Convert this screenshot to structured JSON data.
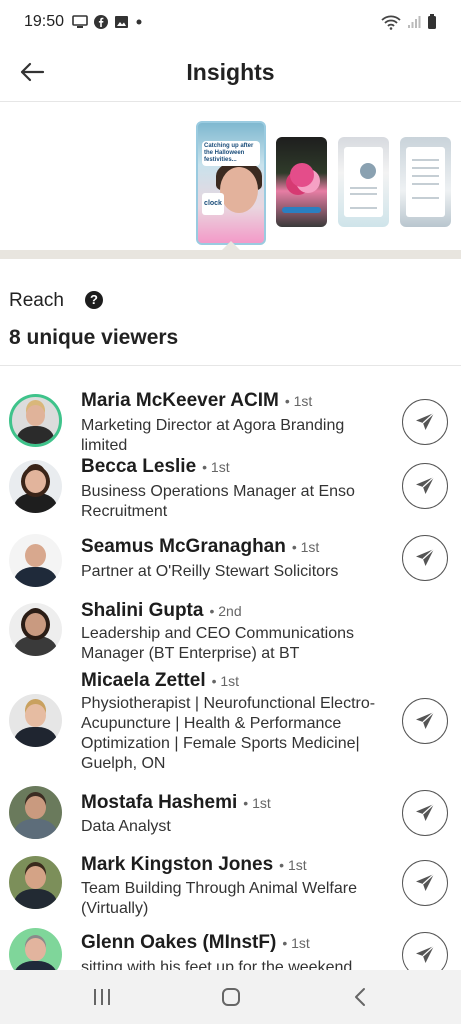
{
  "status_bar": {
    "time": "19:50",
    "left_icons": [
      "monitor-icon",
      "facebook-icon",
      "image-icon",
      "dot-icon"
    ],
    "right_icons": [
      "wifi-icon",
      "signal-icon",
      "battery-icon"
    ]
  },
  "header": {
    "title": "Insights",
    "back_icon": "arrow-left-icon"
  },
  "stories": {
    "items": [
      {
        "caption": "Catching up after the Halloween festivities...",
        "brand": "clock",
        "selected": true
      },
      {
        "caption": "",
        "selected": false
      },
      {
        "caption": "",
        "selected": false
      },
      {
        "caption": "",
        "selected": false
      }
    ]
  },
  "reach": {
    "label": "Reach",
    "help": "?",
    "count_text": "8 unique viewers"
  },
  "viewers": [
    {
      "name": "Maria McKeever ACIM",
      "degree": "• 1st",
      "headline": "Marketing Director at Agora Branding limited",
      "has_send": true
    },
    {
      "name": "Becca Leslie",
      "degree": "• 1st",
      "headline": "Business Operations Manager at Enso Recruitment",
      "has_send": true
    },
    {
      "name": "Seamus McGranaghan",
      "degree": "• 1st",
      "headline": "Partner at O'Reilly Stewart Solicitors",
      "has_send": true
    },
    {
      "name": "Shalini Gupta",
      "degree": "• 2nd",
      "headline": "Leadership and CEO Communications Manager (BT Enterprise) at BT",
      "has_send": false
    },
    {
      "name": "Micaela Zettel",
      "degree": "• 1st",
      "headline": "Physiotherapist | Neurofunctional Electro-Acupuncture | Health & Performance Optimization | Female Sports Medicine| Guelph, ON",
      "has_send": true
    },
    {
      "name": "Mostafa Hashemi",
      "degree": "• 1st",
      "headline": "Data Analyst",
      "has_send": true
    },
    {
      "name": "Mark Kingston Jones",
      "degree": "• 1st",
      "headline": "Team Building Through Animal Welfare (Virtually)",
      "has_send": true
    },
    {
      "name": "Glenn Oakes (MInstF)",
      "degree": "• 1st",
      "headline": "sitting with his feet up for the weekend",
      "has_send": true
    }
  ],
  "navbar": {
    "icons": [
      "recent-apps-icon",
      "home-icon",
      "back-icon"
    ]
  },
  "colors": {
    "accent_ring": "#3fc38b",
    "divider": "#e8e5df"
  }
}
